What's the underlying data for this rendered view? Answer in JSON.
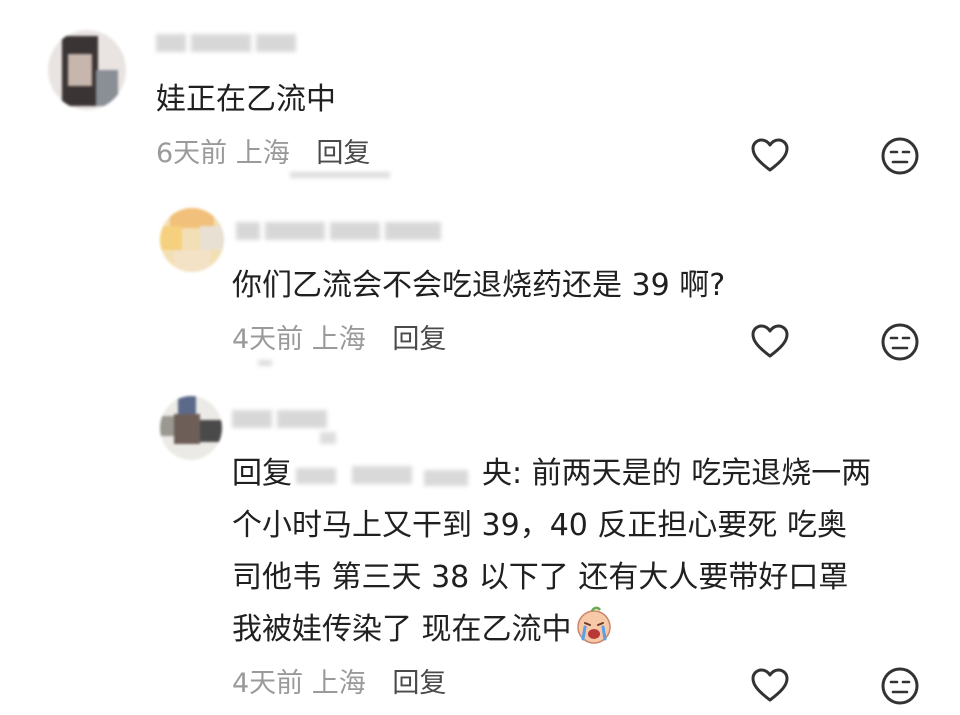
{
  "comments": [
    {
      "text": "娃正在乙流中",
      "time": "6天前",
      "location": "上海",
      "reply_label": "回复"
    },
    {
      "text": "你们乙流会不会吃退烧药还是 39 啊?",
      "time": "4天前",
      "location": "上海",
      "reply_label": "回复"
    },
    {
      "reply_prefix": "回复",
      "mention_tail": "央:",
      "lines": [
        "前两天是的 吃完退烧一两",
        "个小时马上又干到 39，40 反正担心要死 吃奥",
        "司他韦 第三天 38 以下了 还有大人要带好口罩",
        "我被娃传染了 现在乙流中"
      ],
      "emoji": "crying-face-emoji",
      "time": "4天前",
      "location": "上海",
      "reply_label": "回复"
    }
  ],
  "icons": {
    "like": "heart-outline-icon",
    "dislike": "meh-face-icon"
  },
  "colors": {
    "text": "#202020",
    "meta": "#9a9a9a",
    "reply": "#4a4a4a",
    "icon": "#333333"
  }
}
